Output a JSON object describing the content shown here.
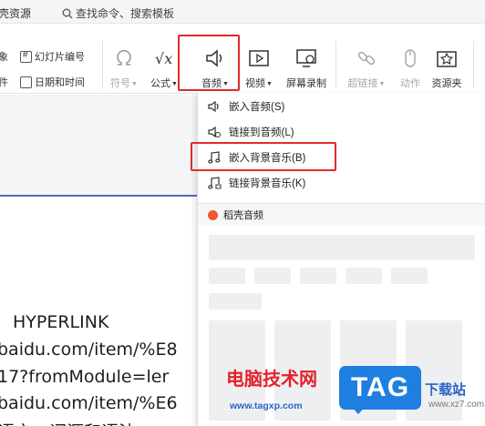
{
  "tabstrip": {
    "left_tab": "稻壳资源",
    "search_placeholder": "查找命令、搜索模板"
  },
  "ribbon": {
    "small_items": {
      "object_partial": "象",
      "file_partial": "件",
      "slide_number": "幻灯片编号",
      "date_time": "日期和时间"
    },
    "buttons": {
      "symbol": "符号",
      "formula": "公式",
      "audio": "音频",
      "video": "视频",
      "screen_record": "屏幕录制",
      "hyperlink": "超链接",
      "action": "动作",
      "resource_clip": "资源夹"
    }
  },
  "dropdown": {
    "items": [
      {
        "label": "嵌入音频(S)"
      },
      {
        "label": "链接到音频(L)"
      },
      {
        "label": "嵌入背景音乐(B)"
      },
      {
        "label": "链接背景音乐(K)"
      }
    ],
    "section_title": "稻壳音频"
  },
  "document": {
    "lines": [
      "HYPERLINK",
      "baidu.com/item/%E8",
      "17?fromModule=ler",
      "baidu.com/item/%E6",
      "语言，词源和语法..."
    ]
  },
  "watermark": {
    "brand_text": "电脑技术网",
    "brand_url": "www.tagxp.com",
    "tag_logo": "TAG",
    "site_name": "下载站",
    "site_url": "www.xz7.com"
  },
  "colors": {
    "highlight_box": "#e02b2b",
    "doc_rule": "#4b6cc1",
    "watermark_red": "#e4232b",
    "watermark_blue": "#1e7fe0"
  }
}
